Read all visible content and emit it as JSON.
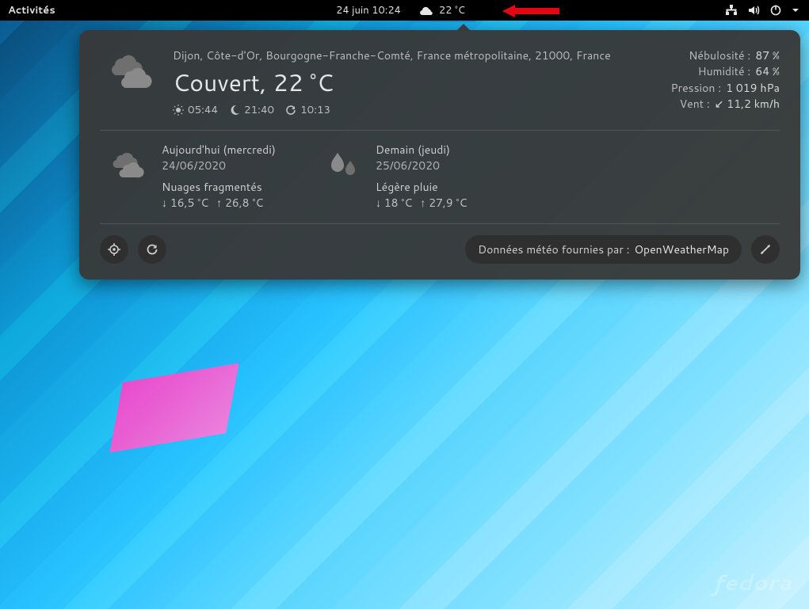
{
  "topbar": {
    "activities": "Activités",
    "datetime": "24 juin  10:24",
    "weather_temp": "22 °C"
  },
  "current": {
    "location": "Dijon, Côte-d'Or, Bourgogne-Franche-Comté, France métropolitaine, 21000, France",
    "condition": "Couvert, 22 °C",
    "sunrise": "05:44",
    "sunset": "21:40",
    "refresh": "10:13",
    "details": {
      "cloud_label": "Nébulosité :",
      "cloud_value": "87 %",
      "humidity_label": "Humidité :",
      "humidity_value": "64 %",
      "pressure_label": "Pression :",
      "pressure_value": "1 019 hPa",
      "wind_label": "Vent :",
      "wind_value": "↙  11,2 km/h"
    }
  },
  "forecast": [
    {
      "day": "Aujourd'hui (mercredi)",
      "date": "24/06/2020",
      "condition": "Nuages fragmentés",
      "low": "↓ 16,5 °C",
      "high": "↑ 26,8 °C",
      "icon": "cloudy"
    },
    {
      "day": "Demain (jeudi)",
      "date": "25/06/2020",
      "condition": "Légère pluie",
      "low": "↓ 18 °C",
      "high": "↑ 27,9 °C",
      "icon": "rain"
    }
  ],
  "footer": {
    "provider_label": "Données météo fournies par :",
    "provider_name": "OpenWeatherMap"
  },
  "branding": {
    "distro": "fedora"
  }
}
